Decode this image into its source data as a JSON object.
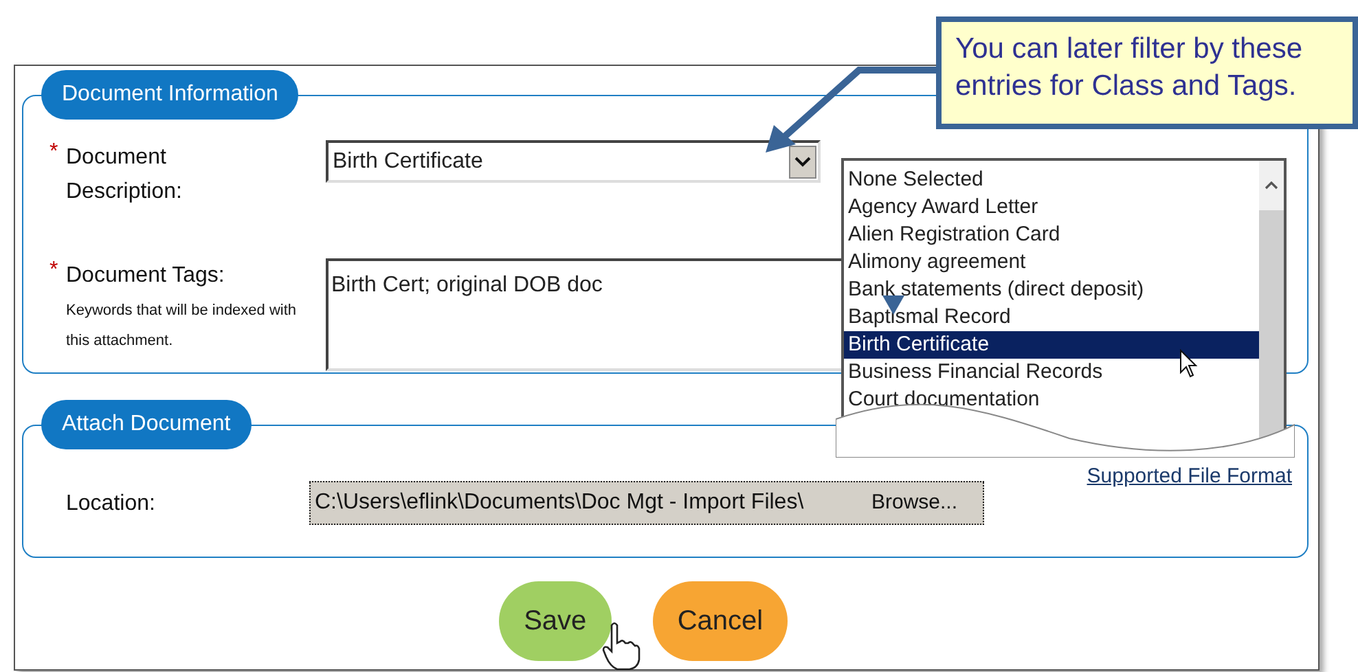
{
  "callout": {
    "text": "You can later filter by these entries for Class and Tags."
  },
  "sections": [
    {
      "legend": "Document Information",
      "fields": [
        {
          "kind": "select",
          "label": "Document Description:",
          "required_mark": "*",
          "value": "Birth Certificate"
        },
        {
          "kind": "textarea",
          "label": "Document Tags:",
          "required_mark": "*",
          "hint": "Keywords that will be indexed with this attachment.",
          "value": "Birth Cert; original DOB doc"
        }
      ]
    },
    {
      "legend": "Attach Document",
      "link": "Supported File Format",
      "fields": [
        {
          "kind": "file",
          "label": "Location:",
          "value": "C:\\Users\\eflink\\Documents\\Doc Mgt - Import Files\\",
          "button": "Browse..."
        }
      ]
    }
  ],
  "dropdown": {
    "options": [
      {
        "label": "None Selected",
        "selected": false
      },
      {
        "label": "Agency Award Letter",
        "selected": false
      },
      {
        "label": "Alien Registration Card",
        "selected": false
      },
      {
        "label": "Alimony agreement",
        "selected": false
      },
      {
        "label": "Bank statements (direct deposit)",
        "selected": false
      },
      {
        "label": "Baptismal Record",
        "selected": false
      },
      {
        "label": "Birth Certificate",
        "selected": true
      },
      {
        "label": "Business Financial Records",
        "selected": false
      },
      {
        "label": "Court documentation",
        "selected": false
      }
    ]
  },
  "buttons": [
    {
      "label": "Save",
      "color": "#a0cf62"
    },
    {
      "label": "Cancel",
      "color": "#f7a533"
    }
  ]
}
